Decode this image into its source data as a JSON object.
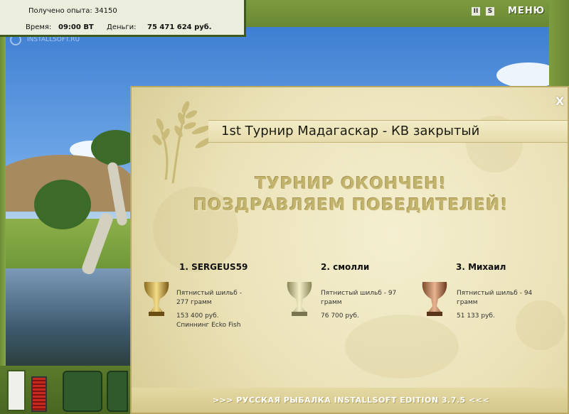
{
  "status": {
    "exp_label": "Получено опыта: 34150",
    "time_label": "Время:",
    "time_value": "09:00 ВТ",
    "money_label": "Деньги:",
    "money_value": "75 471 624 руб."
  },
  "top_controls": {
    "pause": "II",
    "sound": "S",
    "menu": "МЕНЮ"
  },
  "watermark": "INSTALLSOFT.RU",
  "dialog": {
    "close": "X",
    "title": "1st Турнир Мадагаскар - КВ закрытый",
    "headline1": "ТУРНИР ОКОНЧЕН!",
    "headline2": "ПОЗДРАВЛЯЕМ ПОБЕДИТЕЛЕЙ!",
    "winners": [
      {
        "name": "1. SERGEUS59",
        "catch": "Пятнистый шильб - 277 грамм",
        "prize": "153 400 руб. Спиннинг Ecko Fish",
        "cup": "gold-cup"
      },
      {
        "name": "2. смолли",
        "catch": "Пятнистый шильб - 97 грамм",
        "prize": "76 700 руб.",
        "cup": "silver-cup"
      },
      {
        "name": "3. Михаил",
        "catch": "Пятнистый шильб - 94 грамм",
        "prize": "51 133 руб.",
        "cup": "bronze-cup"
      }
    ],
    "footer": ">>> РУССКАЯ РЫБАЛКА INSTALLSOFT EDITION 3.7.5 <<<"
  },
  "colors": {
    "frame_green": "#6f8a3a",
    "dialog_bg": "#efe8c4",
    "headline": "#c2b36c"
  }
}
